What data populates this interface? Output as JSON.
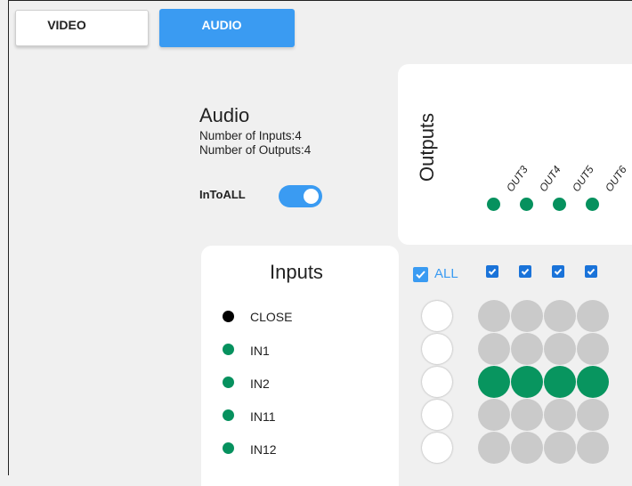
{
  "tabs": {
    "video": "VIDEO",
    "audio": "AUDIO"
  },
  "audio_info": {
    "title": "Audio",
    "inputs_count": "Number of Inputs:4",
    "outputs_count": "Number of Outputs:4"
  },
  "into_all": {
    "label": "InToALL",
    "enabled": true
  },
  "outputs": {
    "title": "Outputs",
    "labels": [
      "OUT3",
      "OUT4",
      "OUT5",
      "OUT6"
    ],
    "dot_color": "#06915e"
  },
  "inputs": {
    "title": "Inputs",
    "items": [
      {
        "label": "CLOSE",
        "color": "#000000"
      },
      {
        "label": "IN1",
        "color": "#06915e"
      },
      {
        "label": "IN2",
        "color": "#06915e"
      },
      {
        "label": "IN11",
        "color": "#06915e"
      },
      {
        "label": "IN12",
        "color": "#06915e"
      }
    ]
  },
  "matrix": {
    "all_label": "ALL",
    "all_checked": true,
    "column_checked": [
      true,
      true,
      true,
      true
    ],
    "active_row": 2,
    "colors": {
      "active": "#08955f",
      "inactive": "#cacaca",
      "accent": "#3a9bf2"
    }
  }
}
